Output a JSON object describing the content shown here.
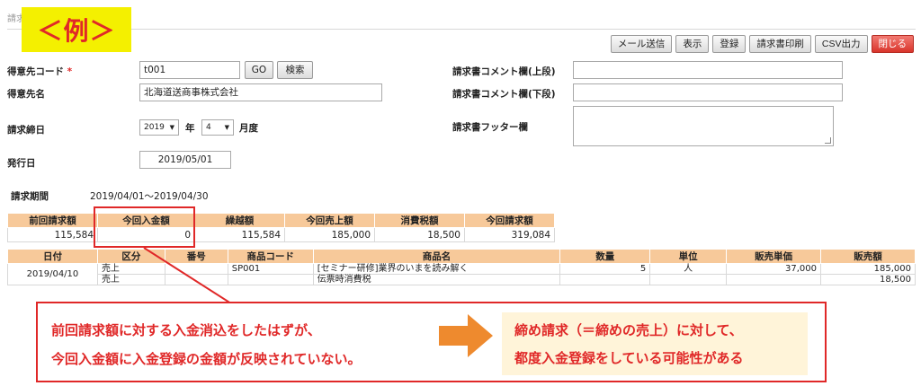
{
  "page": {
    "title_fragment": "請求"
  },
  "example_badge": "＜例＞",
  "toolbar": {
    "mail": "メール送信",
    "display": "表示",
    "register": "登録",
    "print": "請求書印刷",
    "csv": "CSV出力",
    "close": "閉じる"
  },
  "form": {
    "customer_code_label": "得意先コード",
    "required_mark": "*",
    "customer_code_value": "t001",
    "go_button": "GO",
    "search_button": "検索",
    "customer_name_label": "得意先名",
    "customer_name_value": "北海道送商事株式会社",
    "closing_label": "請求締日",
    "year_value": "2019",
    "year_unit": "年",
    "month_value": "4",
    "month_unit": "月度",
    "issue_label": "発行日",
    "issue_value": "2019/05/01",
    "comment_upper_label": "請求書コメント欄(上段)",
    "comment_lower_label": "請求書コメント欄(下段)",
    "footer_label": "請求書フッター欄"
  },
  "period": {
    "label": "請求期間",
    "value": "2019/04/01～2019/04/30"
  },
  "summary": {
    "headers": [
      "前回請求額",
      "今回入金額",
      "繰越額",
      "今回売上額",
      "消費税額",
      "今回請求額"
    ],
    "values": [
      "115,584",
      "0",
      "115,584",
      "185,000",
      "18,500",
      "319,084"
    ]
  },
  "detail": {
    "headers": [
      "日付",
      "区分",
      "番号",
      "商品コード",
      "商品名",
      "数量",
      "単位",
      "販売単価",
      "販売額"
    ],
    "date": "2019/04/10",
    "rows": [
      {
        "kubun": "売上",
        "number": "",
        "code": "SP001",
        "name": "[セミナー研修]業界のいまを読み解く",
        "qty": "5",
        "unit": "人",
        "price": "37,000",
        "amount": "185,000"
      },
      {
        "kubun": "売上",
        "number": "",
        "code": "",
        "name": "伝票時消費税",
        "qty": "",
        "unit": "",
        "price": "",
        "amount": "18,500"
      }
    ]
  },
  "callout": {
    "line1": "前回請求額に対する入金消込をしたはずが、",
    "line2": "今回入金額に入金登録の金額が反映されていない。",
    "note1": "締め請求（＝締めの売上）に対して、",
    "note2": "都度入金登録をしている可能性がある"
  },
  "colors": {
    "accent_red": "#e02828",
    "header_orange": "#f7c99a",
    "badge_yellow": "#f4f000",
    "arrow_orange": "#ee8a2e"
  }
}
